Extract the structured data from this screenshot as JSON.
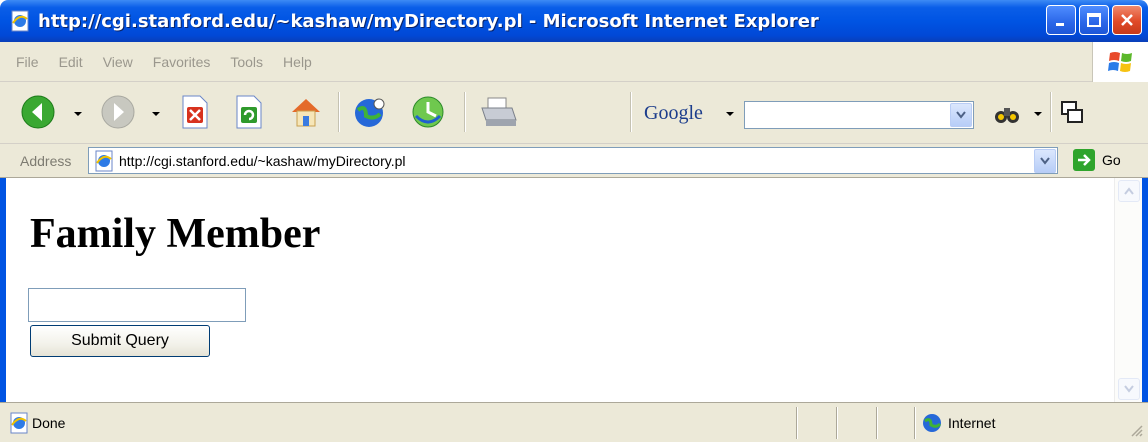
{
  "window": {
    "title": "http://cgi.stanford.edu/~kashaw/myDirectory.pl - Microsoft Internet Explorer"
  },
  "menu": {
    "items": [
      "File",
      "Edit",
      "View",
      "Favorites",
      "Tools",
      "Help"
    ]
  },
  "toolbar": {
    "google_label": "Google",
    "google_search_value": ""
  },
  "address": {
    "label": "Address",
    "url": "http://cgi.stanford.edu/~kashaw/myDirectory.pl",
    "go_label": "Go"
  },
  "page": {
    "heading": "Family Member",
    "input_value": "",
    "submit_label": "Submit Query"
  },
  "status": {
    "text": "Done",
    "zone": "Internet"
  },
  "colors": {
    "titlebar": "#0054e3",
    "chrome": "#ece9d8",
    "field_border": "#7f9db9"
  }
}
